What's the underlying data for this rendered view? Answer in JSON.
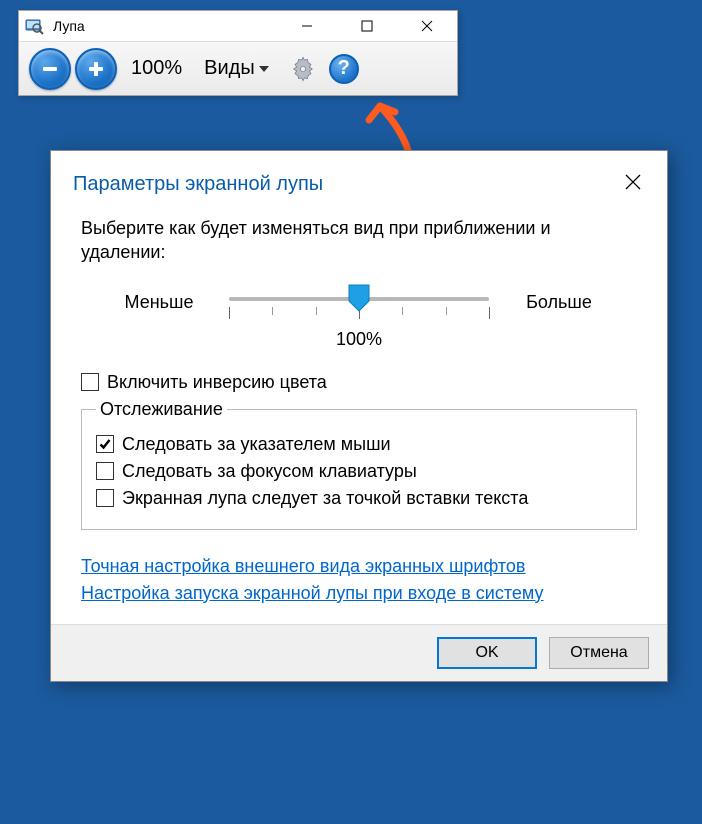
{
  "magnifier": {
    "title": "Лупа",
    "zoom": "100%",
    "views_label": "Виды"
  },
  "settings": {
    "title": "Параметры экранной лупы",
    "instruction": "Выберите как будет изменяться вид при приближении и удалении:",
    "slider": {
      "less": "Меньше",
      "more": "Больше",
      "value": "100%"
    },
    "invert_colors": "Включить инверсию цвета",
    "tracking_legend": "Отслеживание",
    "follow_mouse": "Следовать за указателем мыши",
    "follow_keyboard": "Следовать за фокусом клавиатуры",
    "follow_text": "Экранная лупа следует за точкой вставки текста",
    "link_font": "Точная настройка внешнего вида экранных шрифтов",
    "link_startup": "Настройка запуска экранной лупы при входе в систему",
    "ok": "OK",
    "cancel": "Отмена"
  }
}
